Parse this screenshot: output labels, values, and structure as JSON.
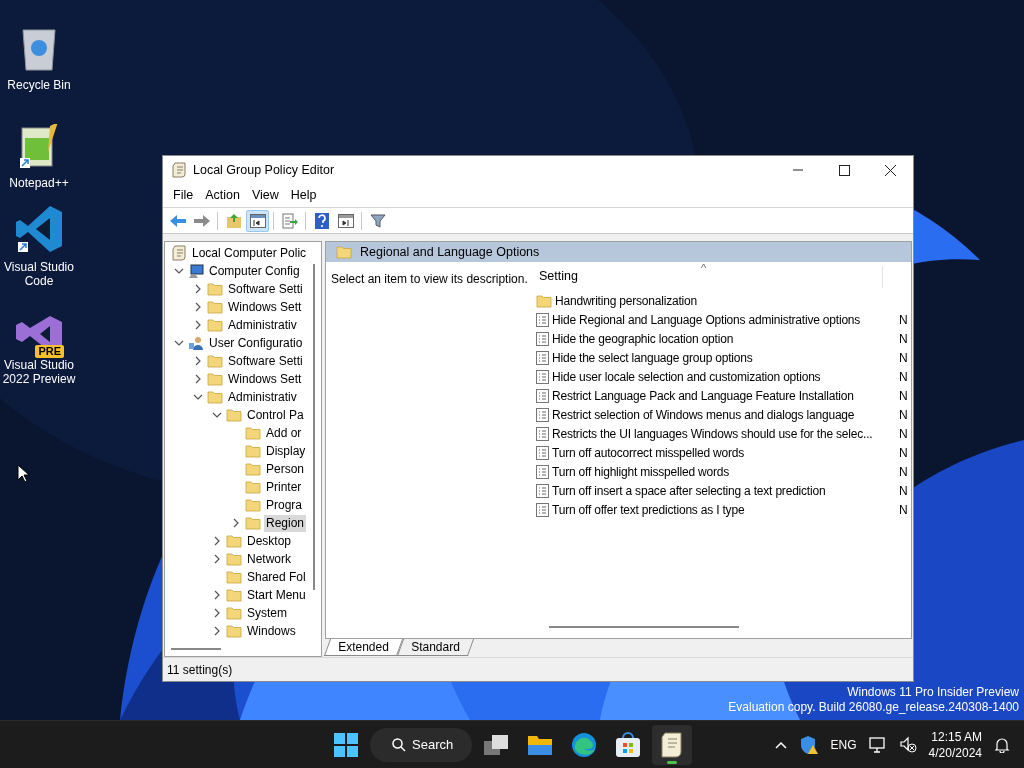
{
  "desktop_icons": [
    {
      "label": "Recycle Bin",
      "kind": "recycle"
    },
    {
      "label": "Notepad++",
      "kind": "notepad"
    },
    {
      "label": "Visual Studio Code",
      "kind": "vscode"
    },
    {
      "label": "Visual Studio 2022 Preview",
      "kind": "vs",
      "badge": "PRE"
    }
  ],
  "window": {
    "title": "Local Group Policy Editor",
    "menu": [
      "File",
      "Action",
      "View",
      "Help"
    ],
    "toolbar": [
      {
        "kind": "back",
        "selected": false
      },
      {
        "kind": "forward",
        "selected": false
      },
      {
        "kind": "sep"
      },
      {
        "kind": "up",
        "selected": false
      },
      {
        "kind": "tree",
        "selected": true
      },
      {
        "kind": "sep"
      },
      {
        "kind": "export",
        "selected": false
      },
      {
        "kind": "sep"
      },
      {
        "kind": "help",
        "selected": false
      },
      {
        "kind": "panel",
        "selected": false
      },
      {
        "kind": "sep"
      },
      {
        "kind": "filter",
        "selected": false
      }
    ],
    "tree": [
      {
        "label": "Local Computer Polic",
        "kind": "policy",
        "selected": false,
        "children": [
          {
            "label": "Computer Config",
            "kind": "computer",
            "has_children": true,
            "expanded": true,
            "selected": false,
            "children": [
              {
                "label": "Software Setti",
                "kind": "folder",
                "has_children": true,
                "expanded": false,
                "selected": false
              },
              {
                "label": "Windows Sett",
                "kind": "folder",
                "has_children": true,
                "expanded": false,
                "selected": false
              },
              {
                "label": "Administrativ",
                "kind": "folder",
                "has_children": true,
                "expanded": false,
                "selected": false
              }
            ]
          },
          {
            "label": "User Configuratio",
            "kind": "user",
            "has_children": true,
            "expanded": true,
            "selected": false,
            "children": [
              {
                "label": "Software Setti",
                "kind": "folder",
                "has_children": true,
                "expanded": false,
                "selected": false
              },
              {
                "label": "Windows Sett",
                "kind": "folder",
                "has_children": true,
                "expanded": false,
                "selected": false
              },
              {
                "label": "Administrativ",
                "kind": "folder",
                "has_children": true,
                "expanded": true,
                "selected": false,
                "children": [
                  {
                    "label": "Control Pa",
                    "kind": "folder",
                    "has_children": true,
                    "expanded": true,
                    "selected": false,
                    "children": [
                      {
                        "label": "Add or",
                        "kind": "folder",
                        "has_children": false,
                        "expanded": false,
                        "selected": false
                      },
                      {
                        "label": "Display",
                        "kind": "folder",
                        "has_children": false,
                        "expanded": false,
                        "selected": false
                      },
                      {
                        "label": "Person",
                        "kind": "folder",
                        "has_children": false,
                        "expanded": false,
                        "selected": false
                      },
                      {
                        "label": "Printer",
                        "kind": "folder",
                        "has_children": false,
                        "expanded": false,
                        "selected": false
                      },
                      {
                        "label": "Progra",
                        "kind": "folder",
                        "has_children": false,
                        "expanded": false,
                        "selected": false
                      },
                      {
                        "label": "Region",
                        "kind": "folder",
                        "has_children": true,
                        "expanded": false,
                        "selected": true
                      }
                    ]
                  },
                  {
                    "label": "Desktop",
                    "kind": "folder",
                    "has_children": true,
                    "expanded": false,
                    "selected": false
                  },
                  {
                    "label": "Network",
                    "kind": "folder",
                    "has_children": true,
                    "expanded": false,
                    "selected": false
                  },
                  {
                    "label": "Shared Fol",
                    "kind": "folder",
                    "has_children": false,
                    "expanded": false,
                    "selected": false
                  },
                  {
                    "label": "Start Menu",
                    "kind": "folder",
                    "has_children": true,
                    "expanded": false,
                    "selected": false
                  },
                  {
                    "label": "System",
                    "kind": "folder",
                    "has_children": true,
                    "expanded": false,
                    "selected": false
                  },
                  {
                    "label": "Windows",
                    "kind": "folder",
                    "has_children": true,
                    "expanded": false,
                    "selected": false
                  }
                ]
              }
            ]
          }
        ]
      }
    ],
    "heading": "Regional and Language Options",
    "description": "Select an item to view its description.",
    "list_header": {
      "column_1": "Setting",
      "sort_mark": "^"
    },
    "rows": [
      {
        "kind": "folder",
        "name": "Handwriting personalization"
      },
      {
        "kind": "setting",
        "name": "Hide Regional and Language Options administrative options",
        "column_2": "N"
      },
      {
        "kind": "setting",
        "name": "Hide the geographic location option",
        "column_2": "N"
      },
      {
        "kind": "setting",
        "name": "Hide the select language group options",
        "column_2": "N"
      },
      {
        "kind": "setting",
        "name": "Hide user locale selection and customization options",
        "column_2": "N"
      },
      {
        "kind": "setting",
        "name": "Restrict Language Pack and Language Feature Installation",
        "column_2": "N"
      },
      {
        "kind": "setting",
        "name": "Restrict selection of Windows menus and dialogs language",
        "column_2": "N"
      },
      {
        "kind": "setting",
        "name": "Restricts the UI languages Windows should use for the selec...",
        "column_2": "N"
      },
      {
        "kind": "setting",
        "name": "Turn off autocorrect misspelled words",
        "column_2": "N"
      },
      {
        "kind": "setting",
        "name": "Turn off highlight misspelled words",
        "column_2": "N"
      },
      {
        "kind": "setting",
        "name": "Turn off insert a space after selecting a text prediction",
        "column_2": "N"
      },
      {
        "kind": "setting",
        "name": "Turn off offer text predictions as I type",
        "column_2": "N"
      }
    ],
    "tabs": [
      {
        "label": "Extended",
        "selected": true
      },
      {
        "label": "Standard",
        "selected": false
      }
    ],
    "status_bar": "11 setting(s)"
  },
  "watermark": [
    "Windows 11 Pro Insider Preview",
    "Evaluation copy. Build 26080.ge_release.240308-1400"
  ],
  "taskbar": {
    "search": "Search",
    "apps": [
      {
        "kind": "taskview",
        "active": false
      },
      {
        "kind": "explorer",
        "active": false
      },
      {
        "kind": "edge",
        "active": false
      },
      {
        "kind": "store",
        "active": false
      },
      {
        "kind": "policy",
        "active": true
      }
    ],
    "tray": {
      "language": "ENG",
      "time": "12:15 AM",
      "date": "4/20/2024"
    }
  }
}
